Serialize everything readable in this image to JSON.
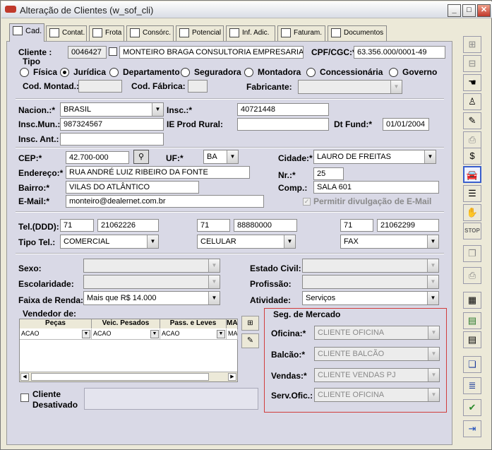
{
  "window": {
    "title": "Alteração de Clientes (w_sof_cli)"
  },
  "tabs": [
    {
      "label": "Cad."
    },
    {
      "label": "Contat."
    },
    {
      "label": "Frota"
    },
    {
      "label": "Consórc."
    },
    {
      "label": "Potencial"
    },
    {
      "label": "Inf. Adic."
    },
    {
      "label": "Faturam."
    },
    {
      "label": "Documentos"
    }
  ],
  "cliente": {
    "label": "Cliente :",
    "code": "0046427",
    "name": "MONTEIRO BRAGA CONSULTORIA EMPRESARIAL LT",
    "cpf_label": "CPF/CGC:*",
    "cpf": "63.356.000/0001-49"
  },
  "tipo": {
    "label": "Tipo",
    "options": [
      {
        "label": "Física",
        "selected": false
      },
      {
        "label": "Jurídica",
        "selected": true
      },
      {
        "label": "Departamento",
        "selected": false
      },
      {
        "label": "Seguradora",
        "selected": false
      },
      {
        "label": "Montadora",
        "selected": false
      },
      {
        "label": "Concessionária",
        "selected": false
      },
      {
        "label": "Governo",
        "selected": false
      }
    ]
  },
  "codMontad": {
    "label": "Cod. Montad.:",
    "value": ""
  },
  "codFabrica": {
    "label": "Cod. Fábrica:",
    "value": ""
  },
  "fabricante": {
    "label": "Fabricante:",
    "value": ""
  },
  "nacion": {
    "label": "Nacion.:*",
    "value": "BRASIL"
  },
  "insc": {
    "label": "Insc.:*",
    "value": "40721448"
  },
  "inscMun": {
    "label": "Insc.Mun.:",
    "value": "987324567"
  },
  "ieProdRural": {
    "label": "IE Prod Rural:",
    "value": ""
  },
  "dtFund": {
    "label": "Dt Fund:*",
    "value": "01/01/2004"
  },
  "inscAnt": {
    "label": "Insc. Ant.:",
    "value": ""
  },
  "cep": {
    "label": "CEP:*",
    "value": "42.700-000"
  },
  "uf": {
    "label": "UF:*",
    "value": "BA"
  },
  "cidade": {
    "label": "Cidade:*",
    "value": "LAURO DE FREITAS"
  },
  "endereco": {
    "label": "Endereço:*",
    "value": "RUA ANDRÉ LUIZ RIBEIRO DA FONTE"
  },
  "nr": {
    "label": "Nr.:*",
    "value": "25"
  },
  "bairro": {
    "label": "Bairro:*",
    "value": "VILAS DO ATLÂNTICO"
  },
  "comp": {
    "label": "Comp.:",
    "value": "SALA 601"
  },
  "email": {
    "label": "E-Mail:*",
    "value": "monteiro@dealernet.com.br",
    "permitir": "Permitir divulgação de E-Mail"
  },
  "tel": {
    "label": "Tel.(DDD):",
    "tipo_label": "Tipo Tel.:",
    "phones": [
      {
        "ddd": "71",
        "num": "21062226",
        "tipo": "COMERCIAL"
      },
      {
        "ddd": "71",
        "num": "88880000",
        "tipo": "CELULAR"
      },
      {
        "ddd": "71",
        "num": "21062299",
        "tipo": "FAX"
      }
    ]
  },
  "sexo": {
    "label": "Sexo:",
    "value": ""
  },
  "estadoCivil": {
    "label": "Estado Civil:",
    "value": ""
  },
  "escolaridade": {
    "label": "Escolaridade:",
    "value": ""
  },
  "profissao": {
    "label": "Profissão:",
    "value": ""
  },
  "faixaRenda": {
    "label": "Faixa de Renda:",
    "value": "Mais que R$ 14.000"
  },
  "atividade": {
    "label": "Atividade:",
    "value": "Serviços"
  },
  "vendedor": {
    "label": "Vendedor de:",
    "columns": [
      "Peças",
      "Veic. Pesados",
      "Pass. e Leves",
      "MA"
    ],
    "row": [
      "ACAO",
      "ACAO",
      "ACAO",
      "MA"
    ]
  },
  "segMercado": {
    "label": "Seg. de Mercado",
    "oficina": {
      "label": "Oficina:*",
      "value": "CLIENTE OFICINA"
    },
    "balcao": {
      "label": "Balcão:*",
      "value": "CLIENTE BALCÃO"
    },
    "vendas": {
      "label": "Vendas:*",
      "value": "CLIENTE VENDAS PJ"
    },
    "servOfic": {
      "label": "Serv.Ofic.:",
      "value": "CLIENTE OFICINA"
    }
  },
  "clienteDesativado": {
    "label1": "Cliente",
    "label2": "Desativado"
  },
  "colors": {
    "accent": "#d13c3c",
    "panel": "#d9d9e6",
    "window": "#ece9d8"
  }
}
